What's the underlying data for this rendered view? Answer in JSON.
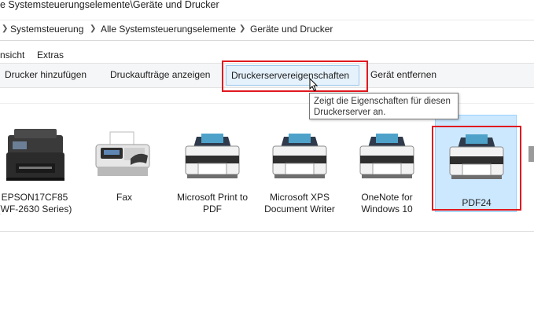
{
  "title": {
    "path": "e Systemsteuerungselemente\\Geräte und Drucker"
  },
  "breadcrumb": [
    "Systemsteuerung",
    "Alle Systemsteuerungselemente",
    "Geräte und Drucker"
  ],
  "menu": {
    "view": "nsicht",
    "extras": "Extras"
  },
  "toolbar": {
    "add_printer": "Drucker hinzufügen",
    "show_jobs": "Druckaufträge anzeigen",
    "server_props": "Druckerservereigenschaften",
    "remove_device": "Gerät entfernen"
  },
  "tooltip": {
    "text": "Zeigt die Eigenschaften für diesen Druckerserver an."
  },
  "devices": [
    {
      "label": "EPSON17CF85 (WF-2630 Series)",
      "icon": "inkjet-printer-icon"
    },
    {
      "label": "Fax",
      "icon": "fax-icon"
    },
    {
      "label": "Microsoft Print to PDF",
      "icon": "printer-icon"
    },
    {
      "label": "Microsoft XPS Document Writer",
      "icon": "printer-icon"
    },
    {
      "label": "OneNote for Windows 10",
      "icon": "printer-icon"
    },
    {
      "label": "PDF24",
      "icon": "printer-icon",
      "selected": true
    }
  ],
  "colors": {
    "highlight": "#e0191f",
    "selection": "#cce8ff",
    "hover": "#e5f1fb"
  }
}
